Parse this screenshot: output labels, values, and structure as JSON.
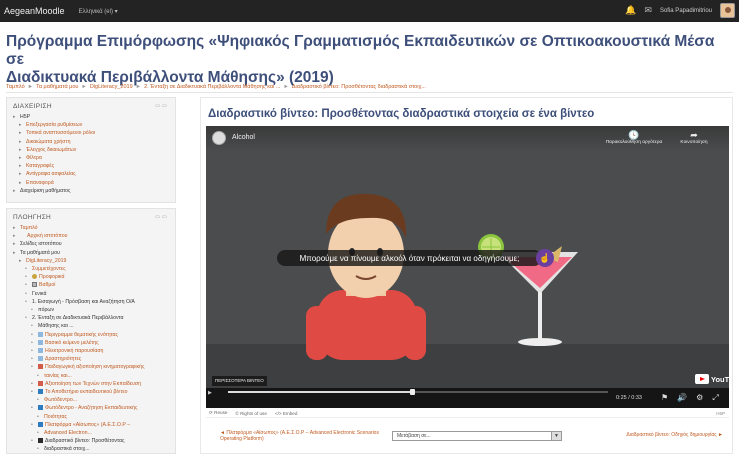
{
  "navbar": {
    "brand": "AegeanMoodle",
    "language": "Ελληνικά (el) ▾",
    "user_name": "Sofia Papadimitriou"
  },
  "course": {
    "title_line1": "Πρόγραμμα Επιμόρφωσης «Ψηφιακός Γραμματισμός Εκπαιδευτικών σε Οπτικοακουστικά Μέσα σε",
    "title_line2": "Διαδικτυακά Περιβάλλοντα Μάθησης» (2019)"
  },
  "breadcrumb": [
    "Ταμπλό",
    "Τα μαθήματά μου",
    "DigLiteracy_2019",
    "2. Ένταξη σε Διαδικτυακά Περιβάλλοντα Μάθησης και ...",
    "Διαδραστικό βίντεο: Προσθέτοντας διαδραστικά στοιχ..."
  ],
  "admin_block": {
    "title": "ΔΙΑΧΕΙΡΙΣΗ",
    "items": [
      {
        "label": "H5P",
        "level": 0,
        "dark": true
      },
      {
        "label": "Επεξεργασία ρυθμίσεων",
        "level": 1
      },
      {
        "label": "Τοπικά αναπτυσσόμενοι ρόλοι",
        "level": 1
      },
      {
        "label": "Δικαιώματα χρήστη",
        "level": 1
      },
      {
        "label": "Έλεγχος δικαιωμάτων",
        "level": 1
      },
      {
        "label": "Φίλτρα",
        "level": 1
      },
      {
        "label": "Καταγραφές",
        "level": 1
      },
      {
        "label": "Αντίγραφα ασφαλείας",
        "level": 1
      },
      {
        "label": "Επαναφορά",
        "level": 1
      },
      {
        "label": "Διαχείριση μαθήματος",
        "level": 0,
        "dark": true
      }
    ]
  },
  "nav_block": {
    "title": "ΠΛΟΗΓΗΣΗ",
    "items": [
      {
        "label": "Ταμπλό",
        "level": 0,
        "icon": ""
      },
      {
        "label": "Αρχική ιστοτόπου",
        "level": 0,
        "icon": "home"
      },
      {
        "label": "Σελίδες ιστοτόπου",
        "level": 0,
        "icon": "",
        "dark": true
      },
      {
        "label": "Τα μαθήματά μου",
        "level": 0,
        "icon": "",
        "dark": true
      },
      {
        "label": "DigLiteracy_2019",
        "level": 1,
        "icon": ""
      },
      {
        "label": "Συμμετέχοντες",
        "level": 2,
        "icon": ""
      },
      {
        "label": "Προφορικά",
        "level": 2,
        "icon": "badge"
      },
      {
        "label": "Βαθμοί",
        "level": 2,
        "icon": "grade"
      },
      {
        "label": "Γενικά",
        "level": 2,
        "icon": "",
        "dark": true
      },
      {
        "label": "1. Εισαγωγή - Πρόσβαση και Αναζήτηση Ο/Α",
        "level": 2,
        "icon": "",
        "dark": true
      },
      {
        "label": "πόρων",
        "level": 3,
        "icon": "",
        "dark": true
      },
      {
        "label": "2. Ένταξη σε Διαδικτυακά Περιβάλλοντα",
        "level": 2,
        "icon": "",
        "dark": true
      },
      {
        "label": "Μάθησης και ...",
        "level": 3,
        "icon": "",
        "dark": true
      },
      {
        "label": "Περιγραμμα θεματικής ενότητας",
        "level": 3,
        "icon": "res"
      },
      {
        "label": "Βασικό κείμενο μελέτης",
        "level": 3,
        "icon": "res"
      },
      {
        "label": "Ηλεκτρονική παρουσίαση",
        "level": 3,
        "icon": "res"
      },
      {
        "label": "Δραστηριότητες",
        "level": 3,
        "icon": "res"
      },
      {
        "label": "Παιδαγωγική αξιοποίηση κινηματογραφικής",
        "level": 3,
        "icon": "flag"
      },
      {
        "label": "ταινίας και...",
        "level": 4,
        "icon": ""
      },
      {
        "label": "Αξιοποίηση των Τεχνών στην Εκπαίδευση",
        "level": 3,
        "icon": "flag"
      },
      {
        "label": "Το Αποθετήριο εκπαιδευτικού βίντεο",
        "level": 3,
        "icon": "pdf"
      },
      {
        "label": "Φωτόδεντρο...",
        "level": 4,
        "icon": ""
      },
      {
        "label": "Φωτόδεντρο - Αναζήτηση Εκπαιδευτικής",
        "level": 3,
        "icon": "pdf"
      },
      {
        "label": "Ποιότητας",
        "level": 4,
        "icon": ""
      },
      {
        "label": "Πλατφόρμα «Αίσωπος» (Α.Ε.Σ.Ο.Ρ –",
        "level": 3,
        "icon": "pdf"
      },
      {
        "label": "Advanced Electron...",
        "level": 4,
        "icon": ""
      },
      {
        "label": "Διαδραστικό βίντεο: Προσθέτοντας",
        "level": 3,
        "icon": "film",
        "dark": true
      },
      {
        "label": "διαδραστικά στοιχ...",
        "level": 4,
        "icon": "",
        "dark": true
      }
    ]
  },
  "activity": {
    "title": "Διαδραστικό βίντεο: Προσθέτοντας διαδραστικά στοιχεία σε ένα βίντεο"
  },
  "video": {
    "channel": "Alcohol",
    "watch_later": "Παρακολούθηση αργότερα",
    "share": "Κοινοποίηση",
    "caption": "Μπορούμε να πίνουμε αλκοόλ όταν πρόκειται να οδηγήσουμε;",
    "more_videos": "ΠΕΡΙΣΣΟΤΕΡΑ ΒΙΝΤΕΟ",
    "youtube": "YouTube",
    "time": "0:25 / 0:33",
    "progress": 0.485
  },
  "h5p": {
    "reuse": "Reuse",
    "rights": "Rights of use",
    "embed": "Embed",
    "h5p": "H5P"
  },
  "activity_nav": {
    "prev": "◄ Πλατφόρμα «Αίσωπος» (Α.Ε.Σ.Ο.Ρ – Advanced Electronic Scenarios Operating Platform)",
    "jump": "Μετάβαση σε...",
    "next": "Διαδραστικό βίντεο: Οδηγός δημιουργίας ►"
  }
}
